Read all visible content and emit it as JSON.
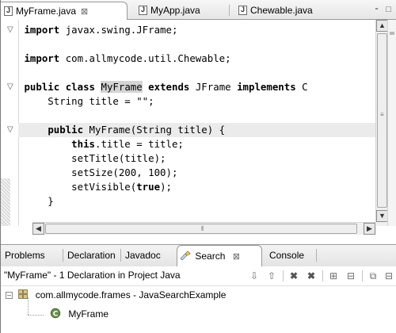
{
  "editor": {
    "tabs": [
      {
        "label": "MyFrame.java",
        "close": "⊠"
      },
      {
        "label": "MyApp.java"
      },
      {
        "label": "Chewable.java"
      }
    ],
    "window_buttons": "⁃ □",
    "code_lines": [
      {
        "parts": [
          [
            "kw",
            "import"
          ],
          [
            "t",
            " javax.swing.JFrame;"
          ]
        ],
        "fold": "▽"
      },
      {
        "parts": []
      },
      {
        "parts": [
          [
            "kw",
            "import"
          ],
          [
            "t",
            " com.allmycode.util.Chewable;"
          ]
        ]
      },
      {
        "parts": []
      },
      {
        "parts": [
          [
            "kw",
            "public"
          ],
          [
            "t",
            " "
          ],
          [
            "kw",
            "class"
          ],
          [
            "t",
            " "
          ],
          [
            "mk",
            "MyFrame"
          ],
          [
            "t",
            " "
          ],
          [
            "kw",
            "extends"
          ],
          [
            "t",
            " JFrame "
          ],
          [
            "kw",
            "implements"
          ],
          [
            "t",
            " C"
          ]
        ],
        "fold": "▽"
      },
      {
        "parts": [
          [
            "t",
            "    String title = \"\";"
          ]
        ]
      },
      {
        "parts": []
      },
      {
        "parts": [
          [
            "t",
            "    "
          ],
          [
            "kw",
            "public"
          ],
          [
            "t",
            " MyFrame(String title) {"
          ]
        ],
        "fold": "▽",
        "highlight": true
      },
      {
        "parts": [
          [
            "t",
            "        "
          ],
          [
            "kw",
            "this"
          ],
          [
            "t",
            ".title = title;"
          ]
        ]
      },
      {
        "parts": [
          [
            "t",
            "        setTitle(title);"
          ]
        ]
      },
      {
        "parts": [
          [
            "t",
            "        setSize(200, 100);"
          ]
        ]
      },
      {
        "parts": [
          [
            "t",
            "        setVisible("
          ],
          [
            "kw",
            "true"
          ],
          [
            "t",
            ");"
          ]
        ]
      },
      {
        "parts": [
          [
            "t",
            "    }"
          ]
        ]
      }
    ]
  },
  "views": {
    "tabs": [
      "Problems",
      "Declaration",
      "Javadoc",
      "Search",
      "Console"
    ],
    "search_close": "⊠",
    "search_label": "\"MyFrame\" - 1 Declaration in Project Java",
    "toolbar_icons": [
      "arrow-down-icon",
      "arrow-up-icon",
      "remove-icon",
      "remove-all-icon",
      "expand-all-icon",
      "collapse-all-icon",
      "pin-icon",
      "history-icon"
    ],
    "results": {
      "package": "com.allmycode.frames - JavaSearchExample",
      "class": "MyFrame"
    }
  }
}
